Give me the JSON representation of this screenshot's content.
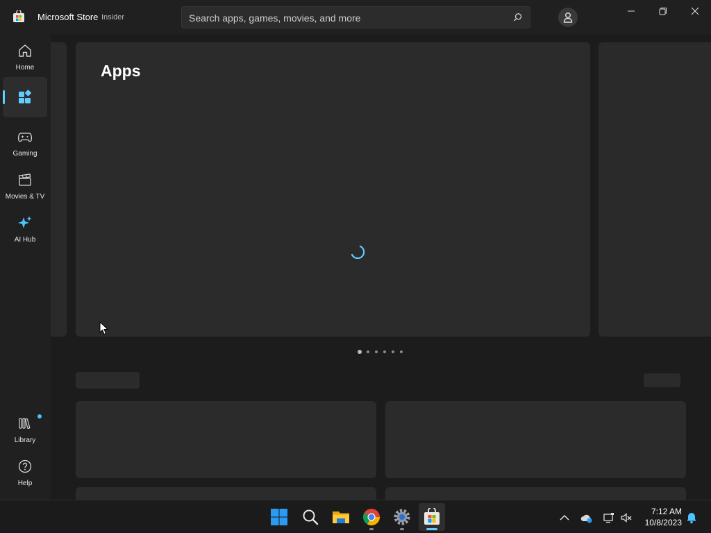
{
  "app": {
    "title": "Microsoft Store",
    "badge": "Insider"
  },
  "search": {
    "placeholder": "Search apps, games, movies, and more"
  },
  "sidebar": {
    "items": [
      {
        "label": "Home",
        "icon": "home-icon"
      },
      {
        "label": "",
        "icon": "apps-icon",
        "active": true
      },
      {
        "label": "Gaming",
        "icon": "gamepad-icon"
      },
      {
        "label": "Movies & TV",
        "icon": "clapperboard-icon"
      },
      {
        "label": "AI Hub",
        "icon": "sparkle-icon"
      }
    ],
    "bottom": [
      {
        "label": "Library",
        "icon": "library-icon",
        "has_notification": true
      },
      {
        "label": "Help",
        "icon": "help-icon"
      }
    ]
  },
  "hero": {
    "title": "Apps",
    "carousel_pages": 6,
    "current_page": 1
  },
  "taskbar": {
    "apps": [
      "start-icon",
      "search-icon",
      "file-explorer-icon",
      "chrome-icon",
      "settings-icon",
      "store-icon"
    ],
    "time": "7:12 AM",
    "date": "10/8/2023"
  },
  "colors": {
    "accent": "#60cdff",
    "background": "#1c1c1c",
    "card": "#2b2b2b"
  }
}
